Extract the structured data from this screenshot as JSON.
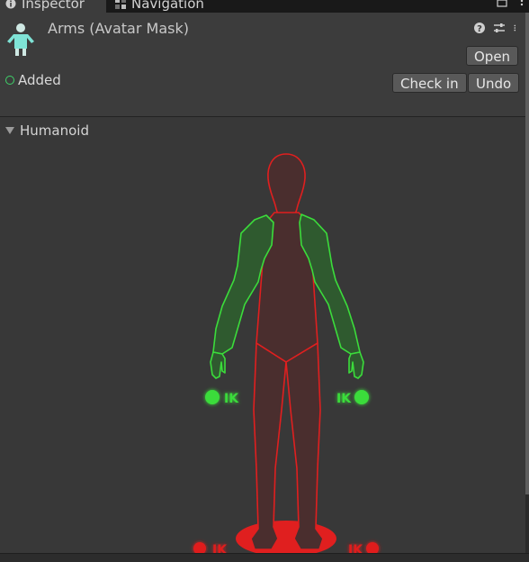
{
  "tabs": [
    {
      "label": "Inspector",
      "icon": "info-icon",
      "active": true
    },
    {
      "label": "Navigation",
      "icon": "navigation-icon",
      "active": false
    }
  ],
  "header": {
    "title": "Arms (Avatar Mask)",
    "open_label": "Open",
    "status_label": "Added",
    "checkin_label": "Check in",
    "undo_label": "Undo"
  },
  "humanoid": {
    "section_label": "Humanoid",
    "ik_labels": {
      "left_hand": "IK",
      "right_hand": "IK",
      "left_foot": "IK",
      "right_foot": "IK"
    },
    "parts": {
      "head": "disabled",
      "body": "disabled",
      "left_arm": "enabled",
      "right_arm": "enabled",
      "left_fingers": "enabled",
      "right_fingers": "enabled",
      "left_leg": "disabled",
      "right_leg": "disabled",
      "root": "disabled",
      "left_hand_ik": "enabled",
      "right_hand_ik": "enabled",
      "left_foot_ik": "disabled",
      "right_foot_ik": "disabled"
    }
  },
  "colors": {
    "enabled": "#3bdc3b",
    "disabled": "#e01f1f",
    "panel_bg": "#383838"
  }
}
